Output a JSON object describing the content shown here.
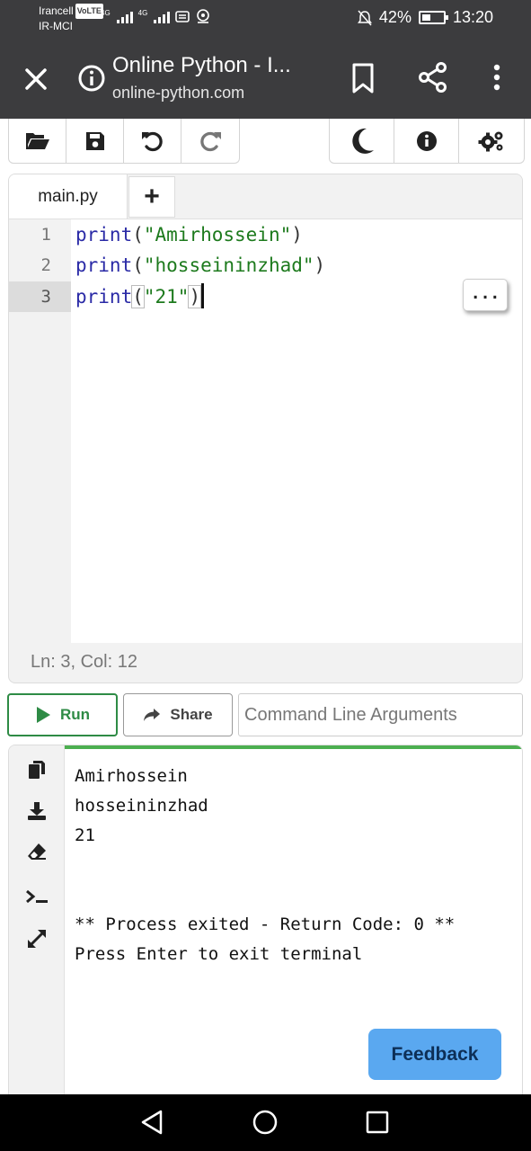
{
  "status_bar": {
    "carrier_line1": "Irancell",
    "volte": "VoLTE",
    "carrier_line2": "IR-MCI",
    "net1": "4G",
    "net2": "4G",
    "battery_percent": "42%",
    "battery_level": 0.42,
    "time": "13:20"
  },
  "browser": {
    "title": "Online Python - I...",
    "host": "online-python.com",
    "icons": [
      "close-icon",
      "info-icon",
      "bookmark-icon",
      "share-icon",
      "more-vert-icon"
    ]
  },
  "toolbar": {
    "left_icons": [
      "folder-open-icon",
      "save-icon",
      "undo-icon",
      "redo-icon"
    ],
    "right_icons": [
      "moon-icon",
      "info-icon",
      "settings-gears-icon"
    ]
  },
  "editor": {
    "tab_name": "main.py",
    "add_tab": "+",
    "lines": [
      {
        "num": "1",
        "kw": "print",
        "open": "(",
        "str": "\"Amirhossein\"",
        "close": ")"
      },
      {
        "num": "2",
        "kw": "print",
        "open": "(",
        "str": "\"hosseininzhad\"",
        "close": ")"
      },
      {
        "num": "3",
        "kw": "print",
        "open": "(",
        "str": "\"21\"",
        "close": ")"
      }
    ],
    "dots_label": "...",
    "status": "Ln: 3,  Col: 12"
  },
  "actions": {
    "run_label": "Run",
    "share_label": "Share",
    "cli_placeholder": "Command Line Arguments"
  },
  "terminal": {
    "output": [
      "Amirhossein",
      "hosseininzhad",
      "21",
      "",
      "",
      "** Process exited - Return Code: 0 **",
      "Press Enter to exit terminal"
    ],
    "side_icons": [
      "copy-icon",
      "download-icon",
      "eraser-icon",
      "terminal-icon",
      "expand-icon"
    ]
  },
  "feedback_label": "Feedback",
  "colors": {
    "status_bg": "#3c3c3e",
    "run_green": "#2e8b45",
    "keyword": "#2a2aa6",
    "string": "#1d7a1d",
    "feedback_bg": "#5aa8f0"
  }
}
